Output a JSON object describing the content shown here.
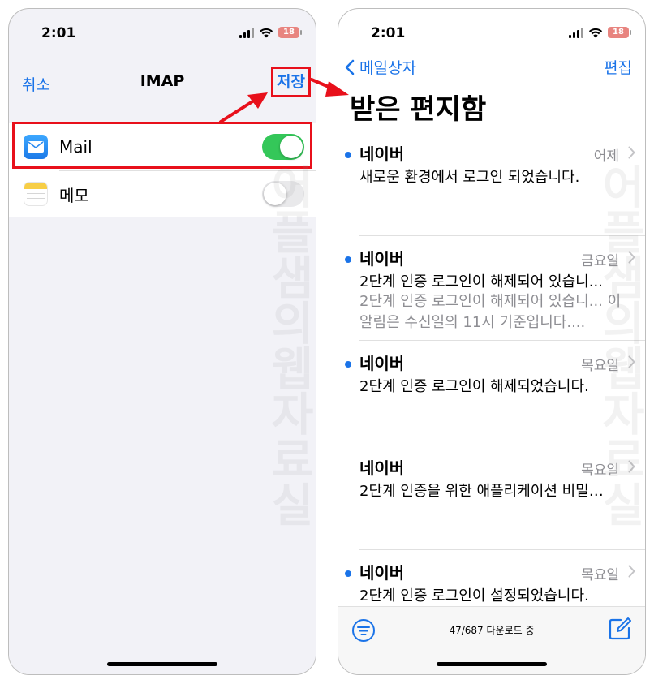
{
  "status_bar": {
    "time": "2:01",
    "battery": "18"
  },
  "imap_screen": {
    "cancel_label": "취소",
    "title": "IMAP",
    "save_label": "저장",
    "settings": [
      {
        "label": "Mail",
        "enabled": true,
        "icon": "mail-icon"
      },
      {
        "label": "메모",
        "enabled": false,
        "icon": "notes-icon"
      }
    ]
  },
  "inbox_screen": {
    "back_label": "메일상자",
    "edit_label": "편집",
    "title": "받은 편지함",
    "emails": [
      {
        "sender": "네이버",
        "date": "어제",
        "subject": "새로운 환경에서 로그인 되었습니다.",
        "preview": "",
        "unread": true
      },
      {
        "sender": "네이버",
        "date": "금요일",
        "subject": "2단계 인증 로그인이 해제되어 있습니...",
        "preview": "2단계 인증 로그인이 해제되어 있습니... 이 알림은 수신일의 11시 기준입니다....",
        "unread": true
      },
      {
        "sender": "네이버",
        "date": "목요일",
        "subject": "2단계 인증 로그인이 해제되었습니다.",
        "preview": "",
        "unread": true
      },
      {
        "sender": "네이버",
        "date": "목요일",
        "subject": "2단계 인증을 위한 애플리케이션 비밀…",
        "preview": "",
        "unread": false
      },
      {
        "sender": "네이버",
        "date": "목요일",
        "subject": "2단계 인증 로그인이 설정되었습니다.",
        "preview": "",
        "unread": true
      }
    ],
    "download_status": "47/687 다운로드 중"
  },
  "watermark": "어플샘의웹자료실",
  "colors": {
    "accent": "#1a73e8",
    "highlight": "#e8101b",
    "toggle_on": "#34c759"
  }
}
